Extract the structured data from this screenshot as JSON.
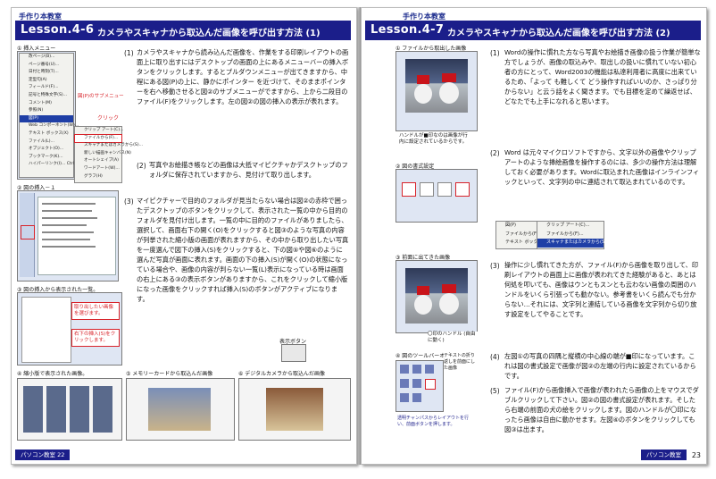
{
  "left": {
    "corner": "手作り本教室",
    "lesson": "Lesson.4-6",
    "title": "カメラやスキャナから取込んだ画像を呼び出す方法 (1)",
    "fig1_caption": "① 挿入メニュー",
    "fig1_menu_items": [
      "改ページ(B)...",
      "ページ番号(U)...",
      "日付と時刻(T)...",
      "定型句(A)",
      "フィールド(F)...",
      "記号と特殊文字(S)...",
      "コメント(M)",
      "参照(N)",
      "Web コンポーネント(W)...",
      "テキスト ボックス(X)",
      "ファイル(L)...",
      "オブジェクト(O)...",
      "ブックマーク(K)...",
      "ハイパーリンク(I)...   Ctrl+K"
    ],
    "fig1_top_item": "図(P)",
    "fig1_sub_items": [
      "クリップ アート(C)...",
      "ファイルから(F)...",
      "スキャナまたはカメラから(S)...",
      "新しい描画キャンバス(N)",
      "オートシェイプ(A)",
      "ワードアート(W)...",
      "グラフ(H)"
    ],
    "fig1_label_submenu": "図(P)のサブメニュー",
    "fig1_label_click": "クリック",
    "fig2_caption": "② 図の挿入－１",
    "fig3_caption": "③ 図の挿入から表示された一覧。",
    "fig3_note1": "取り出したい画像を選びます。",
    "fig3_note2": "右下の挿入(S)をクリックします。",
    "fig_display_button": "表示ボタン",
    "step1_num": "(1)",
    "step1_text": "カメラやスキャナから読み込んだ画像を、作業をする印刷レイアウトの画面上に取り出すにはデスクトップの画面の上にあるメニューバーの挿入ボタンをクリックします。するとプルダウンメニューが出てきますから、中程にある図(P)の上に、静かにポインター を近づけて、そのままポインターを右へ移動させると図②のサブメニューがでますから、上から二段目のファイル(F)をクリックします。左の図②の図の挿入の表示が表れます。",
    "step2_num": "(2)",
    "step2_text": "写真やお絵描き帳などの画像は大抵マイピクチャかデスクトップのフォルダに保存されていますから、見付けて取り出します。",
    "step3_num": "(3)",
    "step3_text": "マイピクチャーで目的のフォルダが見当たらない場合は図②の赤枠で囲ったデスクトップのボタンをクリックして、表示された一覧の中から目的のフォルダを見付け出します。一覧の中に目的のファイルがありましたら、選択して、画面右下の開く(O)をクリックすると図③のような写真の内容が列挙された縮小版の画面が表れますから、その中から取り出したい写真を一度選んで図下の挿入(S)をクリックすると、下の図⑤や図⑥のように選んだ写真が画面に表れます。画面の下の挿入(S)が開く(O)の状態になっている場合や、画像の内容が判らない一覧(L)表示になっている時は画面の右上にある③の表示ボタンがありますから、これをクリックして縮小版になった画像をクリックすれば挿入(S)のボタンがアクティブになります。",
    "fig4_caption": "④ 縮小版で表示された画像。",
    "fig5_caption": "⑤ メモリーカードから取込んだ画像",
    "fig6_caption": "⑥ デジタルカメラから取込んだ画像",
    "footer": "パソコン教室 22",
    "page_number": "22"
  },
  "right": {
    "corner": "手作り本教室",
    "lesson": "Lesson.4-7",
    "title": "カメラやスキャナから取込んだ画像を呼び出す方法 (2)",
    "fig1_caption": "① ファイルから取出した画像",
    "fig1_note": "ハンドルが■印なのは画像が行内に設定されているからです。",
    "fig2_caption": "② 図の書式設定",
    "fig3_caption": "③ 前面に出てきた画像",
    "fig3_note": "〇印のハンドル (自由に動く)",
    "fig4_caption": "④ 図のツールバーオプション",
    "fig4_note": "テキストの折り返しを前面にした画像",
    "fig4_note2": "透明チャンパスからレイアウトを行い、前面ボタンを押します。",
    "menu_items": [
      "図(P)",
      "ファイルから(F)...",
      "テキスト ボックス(X)",
      "クリップ アート(C)...",
      "スキャナまたはカメラから(S)..."
    ],
    "step1_num": "(1)",
    "step1_text": "Wordの操作に慣れた方なら写真やお絵描き画像の扱う作業が簡単な方でしょうが、画像の取込みや、取出しの扱いに慣れていない初心者の方にとって、Word2003の機能は私達利用者に高度に出来ているため、「よって も難しくて どう操作すればいいのか、さっぱり分からない」と云う話をよく聞きます。でも目標を定めて繰返せば、どなたでも上手になれると思います。",
    "step2_num": "(2)",
    "step2_text": "Word は元々マイクロソフトですから、文字以外の画像やクリップアートのような挿絵画像を操作するのには、多少の操作方法は理解しておく必要があります。Wordに取込まれた画像はインラインフィックといって、文字列の中に連結されて取込まれているのです。",
    "step3_num": "(3)",
    "step3_text": "操作に少し慣れてきた方が、ファイル(F)から画像を取り出して、印刷レイアウトの画面上に画像が表われてきた経験があると、あとは何処を叩いても、画像はウンともスンとも云わない画像の周囲のハンドルをいくら引張っても動かない。参考書をいくら読んでも分からない…それには、文字列と連結している画像を文字列から切り放す設定をしてやることです。",
    "step4_num": "(4)",
    "step4_text": "左図①の写真の四隅と縦横の中心線の端が■印になっています。これは図の書式設定で画像が図②の左端の行内に設定されているからです。",
    "step5_num": "(5)",
    "step5_text": "ファイル(F)から画像挿入で画像が表われたら画像の上をマウスでダブルクリックして下さい。図②の図の書式設定が表れます。そしたら右端の前面の犬の絵をクリックします。図のハンドルが〇印になったら画像は自由に動かせます。左図④のボタンをクリックしても図③は出ます。",
    "footer": "パソコン教室",
    "page_number": "23"
  },
  "colors": {
    "accent": "#1b1e8a",
    "highlight": "#d8232a"
  }
}
